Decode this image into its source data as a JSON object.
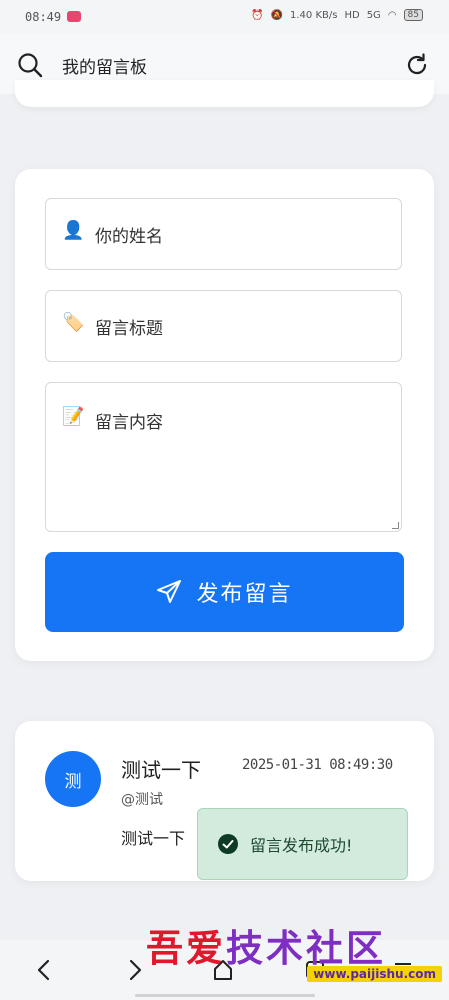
{
  "status_bar": {
    "time": "08:49",
    "speed": "1.40",
    "speed_unit": "KB/s",
    "hd": "HD",
    "network": "5G",
    "battery": "85"
  },
  "header": {
    "title": "我的留言板"
  },
  "form": {
    "name_placeholder": "你的姓名",
    "name_emoji": "👤",
    "title_placeholder": "留言标题",
    "title_emoji": "🏷️",
    "content_placeholder": "留言内容",
    "content_emoji": "📝",
    "submit_label": "发布留言",
    "accent_color": "#1575f4"
  },
  "messages": [
    {
      "avatar_text": "测",
      "title": "测试一下",
      "timestamp": "2025-01-31 08:49:30",
      "author": "@测试",
      "body": "测试一下"
    }
  ],
  "toast": {
    "text": "留言发布成功!",
    "color": "#d3ebdd"
  },
  "watermark": {
    "main_a": "吾爱",
    "main_b": "技术社区",
    "url": "www.paijishu.com"
  }
}
